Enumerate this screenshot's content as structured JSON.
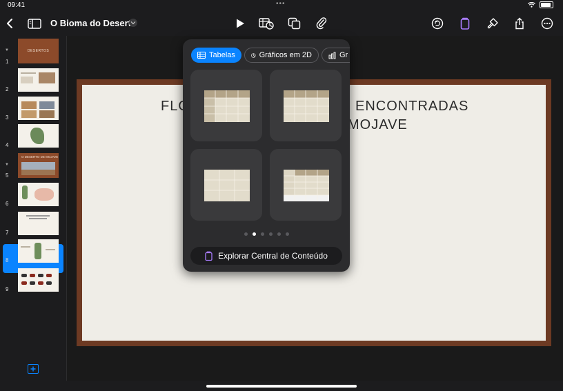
{
  "status_bar": {
    "time": "09:41",
    "dots": "•••"
  },
  "toolbar": {
    "document_title": "O Bioma do Deserto"
  },
  "sidebar": {
    "slides": [
      {
        "number": "1",
        "group": true,
        "label": "DESERTOS"
      },
      {
        "number": "2"
      },
      {
        "number": "3"
      },
      {
        "number": "4"
      },
      {
        "number": "5",
        "group": true,
        "label": "O DESERTO DE MOJAVE"
      },
      {
        "number": "6"
      },
      {
        "number": "7",
        "selected": true
      },
      {
        "number": "8"
      },
      {
        "number": "9"
      }
    ]
  },
  "slide": {
    "title_left": "FLO",
    "title_right_1": "ENCONTRADAS",
    "title_right_2": "MOJAVE"
  },
  "popover": {
    "tabs": [
      {
        "label": "Tabelas",
        "icon": "table-icon",
        "active": true
      },
      {
        "label": "Gráficos em 2D",
        "icon": "chart-2d-icon",
        "active": false
      },
      {
        "label": "Gr",
        "icon": "chart-3d-icon",
        "active": false
      }
    ],
    "page_count": 6,
    "current_page": 2,
    "explore_label": "Explorar Central de Conteúdo"
  },
  "colors": {
    "accent": "#0a84ff",
    "content_hub": "#a97dff",
    "slide_frame": "#6d3a23",
    "table_header": "#b3a488",
    "table_body": "#e2dccb"
  }
}
